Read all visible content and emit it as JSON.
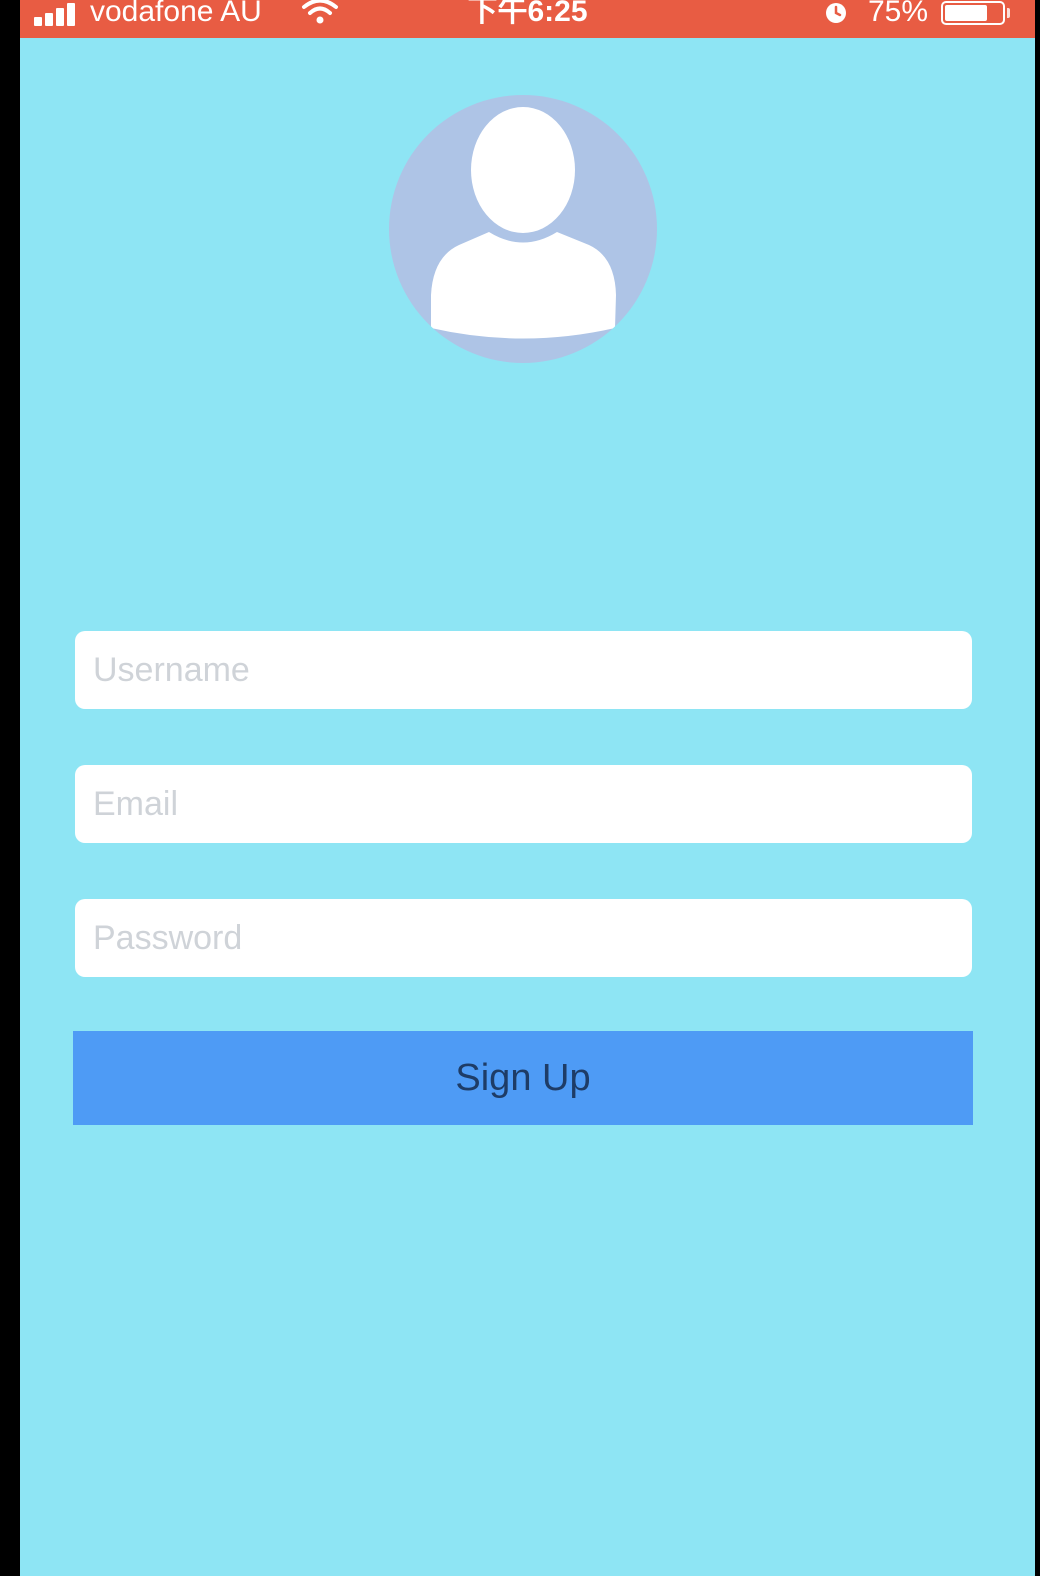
{
  "status_bar": {
    "carrier": "vodafone AU",
    "time": "下午6:25",
    "battery_percent": "75%",
    "battery_level": 0.75,
    "icons": [
      "signal-bars-icon",
      "wifi-icon",
      "alarm-icon",
      "battery-icon"
    ],
    "background_color": "#e85c43"
  },
  "profile": {
    "avatar_icon": "user-silhouette-icon"
  },
  "form": {
    "username_placeholder": "Username",
    "email_placeholder": "Email",
    "password_placeholder": "Password",
    "signup_label": "Sign Up"
  },
  "colors": {
    "background": "#8ee5f4",
    "button": "#4e9bf5",
    "button_text": "#1e3c66",
    "avatar_circle": "#aec4e6"
  }
}
